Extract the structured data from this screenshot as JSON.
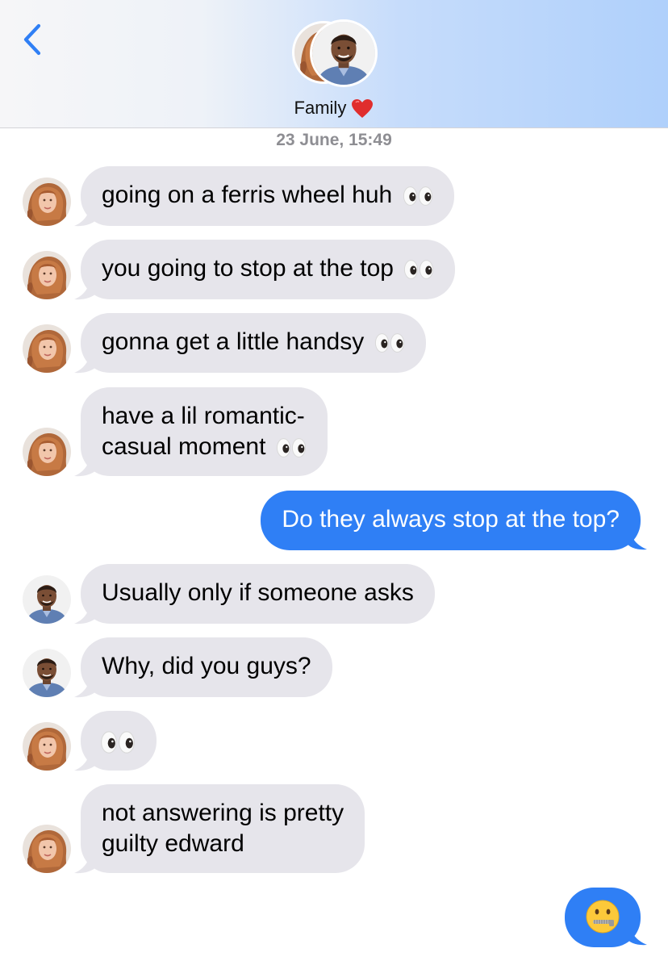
{
  "header": {
    "back_icon": "chevron-left-icon",
    "group_name": "Family",
    "heart": "❤️",
    "accent_color": "#2f7ff5"
  },
  "timestamp": "23 June, 15:49",
  "messages": [
    {
      "id": 0,
      "side": "in",
      "sender": "woman",
      "text": "going on a ferris wheel huh",
      "emoji": "👀"
    },
    {
      "id": 1,
      "side": "in",
      "sender": "woman",
      "text": "you going to stop at the top",
      "emoji": "👀"
    },
    {
      "id": 2,
      "side": "in",
      "sender": "woman",
      "text": "gonna get a little handsy",
      "emoji": "👀"
    },
    {
      "id": 3,
      "side": "in",
      "sender": "woman",
      "text_line1": "have a lil romantic-",
      "text_line2": "casual moment",
      "emoji": "👀"
    },
    {
      "id": 4,
      "side": "out",
      "sender": "me",
      "text": "Do they always stop at the top?"
    },
    {
      "id": 5,
      "side": "in",
      "sender": "man",
      "text": "Usually only if someone asks"
    },
    {
      "id": 6,
      "side": "in",
      "sender": "man",
      "text": "Why, did you guys?"
    },
    {
      "id": 7,
      "side": "in",
      "sender": "woman",
      "emoji": "👀"
    },
    {
      "id": 8,
      "side": "in",
      "sender": "woman",
      "text_line1": "not answering is pretty",
      "text_line2": "guilty edward"
    },
    {
      "id": 9,
      "side": "out",
      "sender": "me",
      "emoji": "🤐"
    }
  ],
  "colors": {
    "incoming_bubble": "#e6e5eb",
    "outgoing_bubble": "#2f7ff5"
  }
}
